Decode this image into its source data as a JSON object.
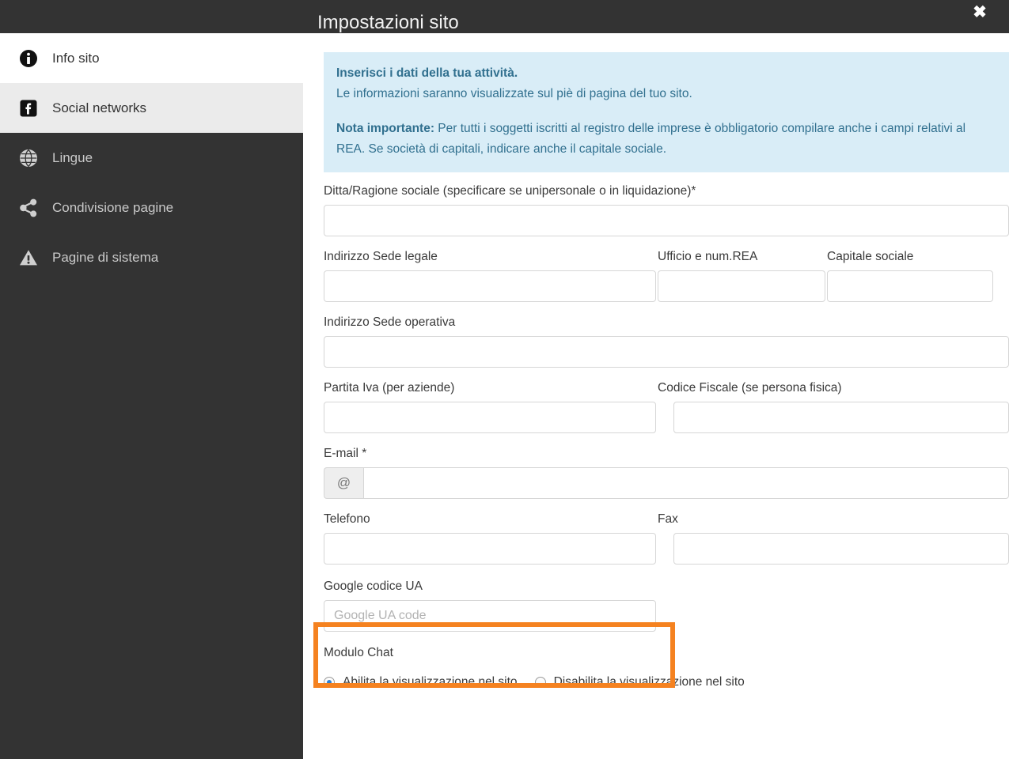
{
  "window": {
    "title": "Impostazioni sito",
    "close_label": "✖"
  },
  "sidebar": {
    "items": [
      {
        "label": "Info sito",
        "icon": "info-circle-icon",
        "state": "white"
      },
      {
        "label": "Social networks",
        "icon": "facebook-icon",
        "state": "active"
      },
      {
        "label": "Lingue",
        "icon": "globe-icon",
        "state": "dark"
      },
      {
        "label": "Condivisione pagine",
        "icon": "share-nodes-icon",
        "state": "dark"
      },
      {
        "label": "Pagine di sistema",
        "icon": "warning-triangle-icon",
        "state": "dark"
      }
    ]
  },
  "alert": {
    "heading": "Inserisci i dati della tua attività.",
    "subtext": "Le informazioni saranno visualizzate sul piè di pagina del tuo sito.",
    "note_label": "Nota importante:",
    "note_text": " Per tutti i soggetti iscritti al registro delle imprese è obbligatorio compilare anche i campi relativi al REA. Se società di capitali, indicare anche il capitale sociale."
  },
  "form": {
    "ragione_sociale_label": "Ditta/Ragione sociale (specificare se unipersonale o in liquidazione)*",
    "ragione_sociale_value": "",
    "sede_legale_label": "Indirizzo Sede legale",
    "sede_legale_value": "",
    "ufficio_rea_label": "Ufficio e num.REA",
    "ufficio_rea_value": "",
    "capitale_sociale_label": "Capitale sociale",
    "capitale_sociale_value": "",
    "sede_operativa_label": "Indirizzo Sede operativa",
    "sede_operativa_value": "",
    "partita_iva_label": "Partita Iva (per aziende)",
    "partita_iva_value": "",
    "codice_fiscale_label": "Codice Fiscale (se persona fisica)",
    "codice_fiscale_value": "",
    "email_label": "E-mail *",
    "email_addon": "@",
    "email_value": "",
    "telefono_label": "Telefono",
    "telefono_value": "",
    "fax_label": "Fax",
    "fax_value": "",
    "google_ua_label": "Google codice UA",
    "google_ua_value": "",
    "google_ua_placeholder": "Google UA code",
    "modulo_chat_label": "Modulo Chat",
    "chat_enable_label": "Abilita la visualizzazione nel sito",
    "chat_disable_label": "Disabilita la visualizzazione nel sito",
    "chat_selected": "enable"
  },
  "colors": {
    "chrome_dark": "#333333",
    "sidebar_active": "#ebebeb",
    "alert_bg": "#d9edf7",
    "alert_text": "#31708f",
    "highlight_orange": "#f58220",
    "radio_blue": "#2a7fd4"
  }
}
